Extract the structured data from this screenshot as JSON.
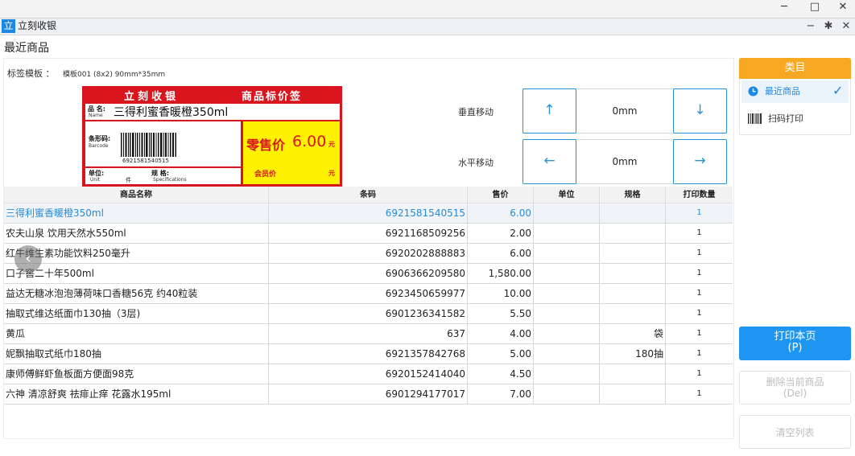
{
  "window": {
    "minimize": "─",
    "maximize": "□",
    "close": "✕"
  },
  "app": {
    "icon_glyph": "立",
    "title": "立刻收银",
    "ctrl_min": "−",
    "ctrl_pin": "✱",
    "ctrl_close": "✕"
  },
  "page_title": "最近商品",
  "template": {
    "label": "标签模板 ：",
    "value": "模板001 (8x2)  90mm*35mm"
  },
  "price_label": {
    "brand": "立刻收银",
    "type": "商品标价签",
    "name_cap": "品 名:",
    "name_en": "Name",
    "name_value": "三得利蜜香暖橙350ml",
    "barcode_cap": "条形码:",
    "barcode_en": "Barcode",
    "barcode_value": "6921581540515",
    "unit_cap": "单位:",
    "unit_en": "Unit",
    "unit_suffix": "件",
    "spec_cap": "规   格:",
    "spec_en": "Specifications",
    "sale_cap": "零售价",
    "sale_value": "6.00",
    "sale_unit": "元",
    "member_cap": "会员价",
    "member_unit": "元"
  },
  "controls": {
    "vertical_label": "垂直移动",
    "vertical_value": "0mm",
    "horizontal_label": "水平移动",
    "horizontal_value": "0mm",
    "up": "↑",
    "down": "↓",
    "left": "←",
    "right": "→"
  },
  "table": {
    "headers": [
      "商品名称",
      "条码",
      "售价",
      "单位",
      "规格",
      "打印数量"
    ],
    "rows": [
      {
        "name": "三得利蜜香暖橙350ml",
        "barcode": "6921581540515",
        "price": "6.00",
        "unit": "",
        "spec": "",
        "qty": "1"
      },
      {
        "name": "农夫山泉 饮用天然水550ml",
        "barcode": "6921168509256",
        "price": "2.00",
        "unit": "",
        "spec": "",
        "qty": "1"
      },
      {
        "name": "红牛维生素功能饮料250毫升",
        "barcode": "6920202888883",
        "price": "6.00",
        "unit": "",
        "spec": "",
        "qty": "1"
      },
      {
        "name": "口子窖二十年500ml",
        "barcode": "6906366209580",
        "price": "1,580.00",
        "unit": "",
        "spec": "",
        "qty": "1"
      },
      {
        "name": "益达无糖冰泡泡薄荷味口香糖56克 约40粒装",
        "barcode": "6923450659977",
        "price": "10.00",
        "unit": "",
        "spec": "",
        "qty": "1"
      },
      {
        "name": "抽取式维达纸面巾130抽（3层)",
        "barcode": "6901236341582",
        "price": "5.50",
        "unit": "",
        "spec": "",
        "qty": "1"
      },
      {
        "name": "黄瓜",
        "barcode": "637",
        "price": "4.00",
        "unit": "",
        "spec": "袋",
        "qty": "1"
      },
      {
        "name": "妮飘抽取式纸巾180抽",
        "barcode": "6921357842768",
        "price": "5.00",
        "unit": "",
        "spec": "180抽",
        "qty": "1"
      },
      {
        "name": "康师傅鲜虾鱼板面方便面98克",
        "barcode": "6920152414040",
        "price": "4.50",
        "unit": "",
        "spec": "",
        "qty": "1"
      },
      {
        "name": "六神 清凉舒爽 祛痱止痒 花露水195ml",
        "barcode": "6901294177017",
        "price": "7.00",
        "unit": "",
        "spec": "",
        "qty": "1"
      }
    ]
  },
  "sidebar": {
    "category_header": "类目",
    "recent": "最近商品",
    "scan_print": "扫码打印",
    "check": "✓",
    "print_label": "打印本页",
    "print_key": "(P)",
    "delete_label": "删除当前商品",
    "delete_key": "(Del)",
    "clear_label": "清空列表"
  },
  "colors": {
    "accent": "#1e95f0",
    "category": "#f6a823",
    "label_red": "#d9151e",
    "label_yellow": "#fff200",
    "selected_text": "#2a8ad4"
  }
}
